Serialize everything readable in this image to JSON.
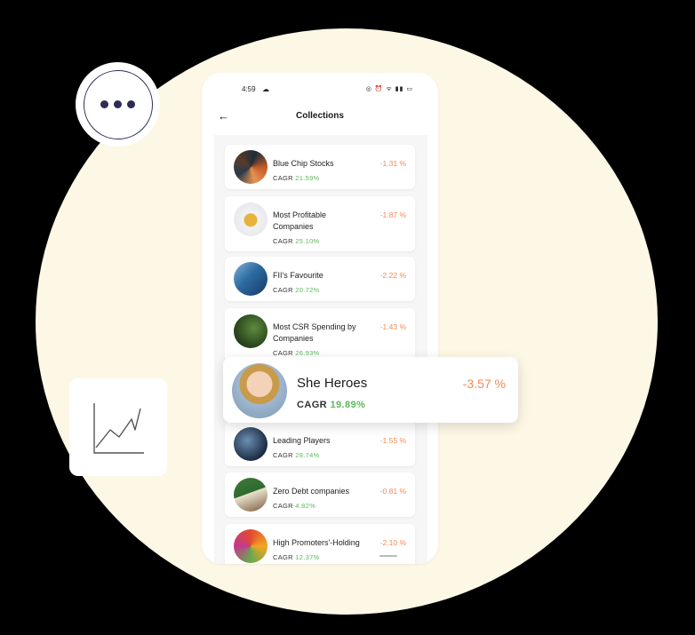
{
  "status_bar": {
    "time": "4:59",
    "icons": "◎ ⏰ ᯤ ▮▮ ▭"
  },
  "header": {
    "title": "Collections"
  },
  "cagr_label": "CAGR",
  "collections": [
    {
      "name_line1": "Blue Chip Stocks",
      "name_line2": "",
      "change": "-1.31 %",
      "cagr": "21.59%"
    },
    {
      "name_line1": "Most Profitable",
      "name_line2": "Companies",
      "change": "-1.87 %",
      "cagr": "25.10%"
    },
    {
      "name_line1": "FII's Favourite",
      "name_line2": "",
      "change": "-2.22 %",
      "cagr": "20.72%"
    },
    {
      "name_line1": "Most CSR Spending by",
      "name_line2": "Companies",
      "change": "-1.43 %",
      "cagr": "26.93%"
    },
    {
      "name_line1": "Leading Players",
      "name_line2": "",
      "change": "-1.55 %",
      "cagr": "28.74%"
    },
    {
      "name_line1": "Zero Debt companies",
      "name_line2": "",
      "change": "-0.81 %",
      "cagr": "4.82%"
    },
    {
      "name_line1": "High Promoters'-Holding",
      "name_line2": "",
      "change": "-2.10 %",
      "cagr": "12.37%"
    }
  ],
  "featured": {
    "name": "She Heroes",
    "change": "-3.57 %",
    "cagr": "19.89%"
  },
  "colors": {
    "negative": "#f08a55",
    "positive": "#5cb85c",
    "background_blob": "#fdf7e6",
    "icon_stroke": "#2e2b55"
  },
  "icons": {
    "more": "more-dots-icon",
    "chart": "line-chart-icon",
    "back": "back-arrow-icon"
  }
}
